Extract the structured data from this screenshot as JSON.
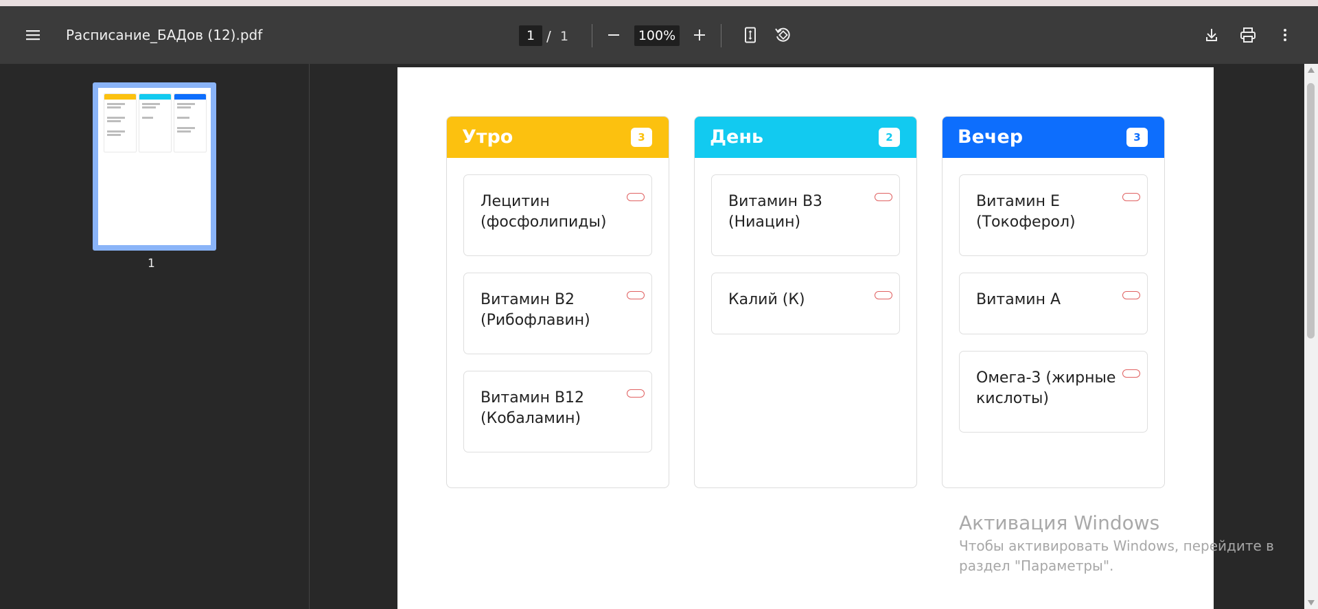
{
  "toolbar": {
    "title": "Расписание_БАДов (12).pdf",
    "page_current": "1",
    "page_sep": "/",
    "page_total": "1",
    "zoom": "100%",
    "icons": [
      "menu-icon",
      "minus-icon",
      "plus-icon",
      "fit-page-icon",
      "rotate-icon",
      "download-icon",
      "print-icon",
      "more-vert-icon"
    ]
  },
  "sidebar": {
    "thumbnail_label": "1"
  },
  "schedule": {
    "columns": [
      {
        "title": "Утро",
        "count": "3",
        "color": "#fcc10f",
        "items": [
          "Лецитин (фосфолипиды)",
          "Витамин B2 (Рибофлавин)",
          "Витамин B12 (Кобаламин)"
        ]
      },
      {
        "title": "День",
        "count": "2",
        "color": "#12caf0",
        "items": [
          "Витамин B3 (Ниацин)",
          "Калий (К)"
        ]
      },
      {
        "title": "Вечер",
        "count": "3",
        "color": "#0d6efd",
        "items": [
          "Витамин E (Токоферол)",
          "Витамин А",
          "Омега-3 (жирные кислоты)"
        ]
      }
    ]
  },
  "watermark": {
    "title": "Активация Windows",
    "line1": "Чтобы активировать Windows, перейдите в",
    "line2": "раздел \"Параметры\"."
  }
}
